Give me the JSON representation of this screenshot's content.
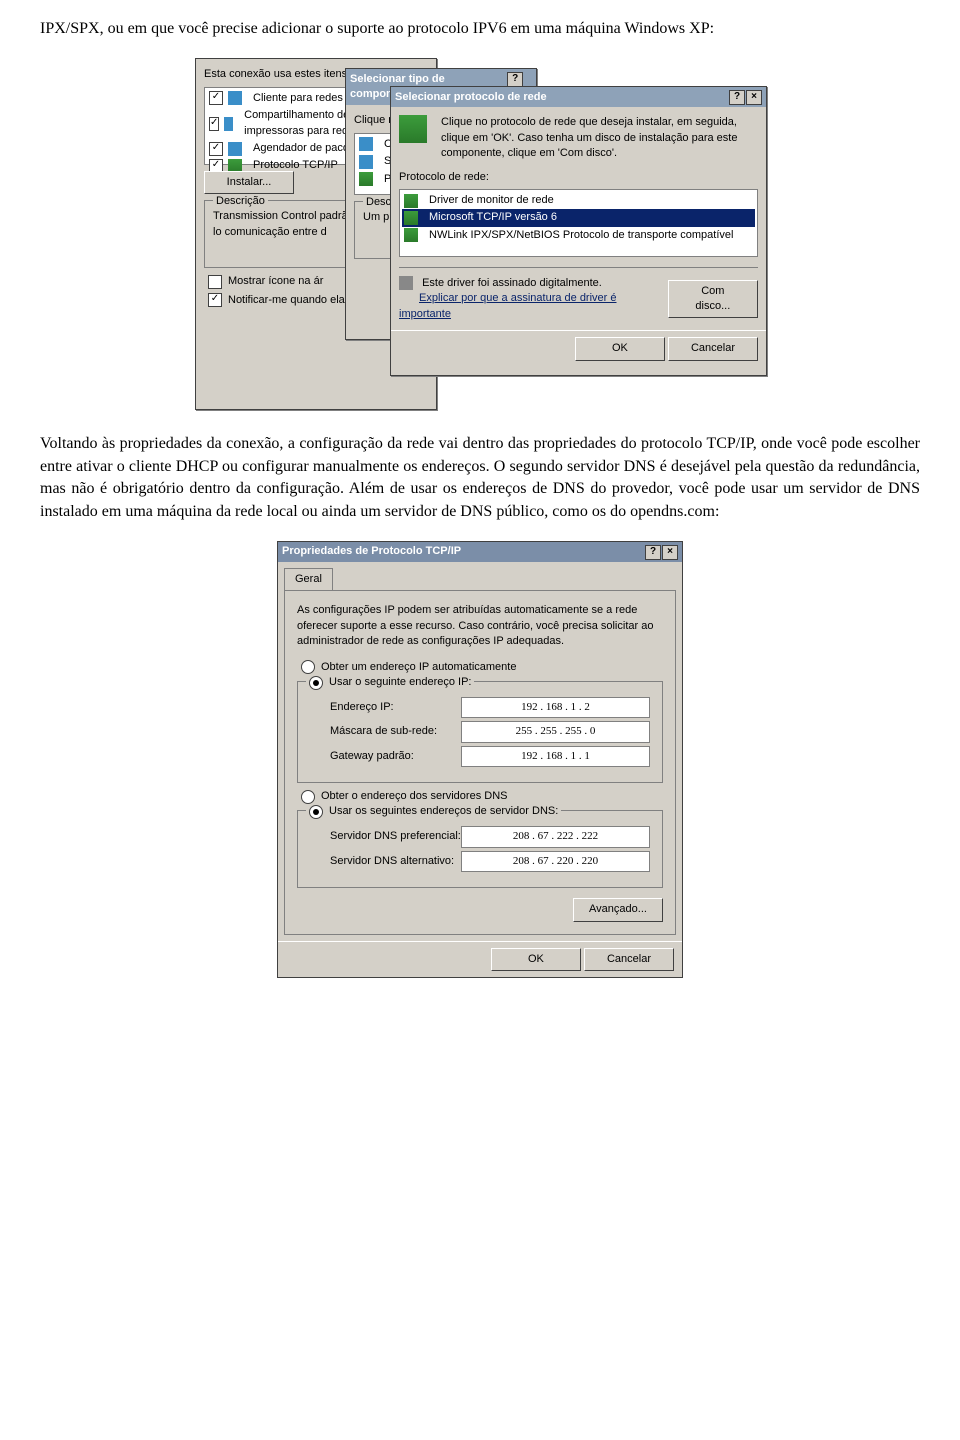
{
  "intro_text": "IPX/SPX, ou em que você precise adicionar o suporte ao protocolo IPV6 em uma máquina Windows XP:",
  "middle_text": "Voltando às propriedades da conexão, a configuração da rede vai dentro das propriedades do protocolo TCP/IP, onde você pode escolher entre ativar o cliente DHCP ou configurar manualmente os endereços. O segundo servidor DNS é desejável pela questão da redundância, mas não é obrigatório dentro da configuração. Além de usar os endereços de DNS do provedor, você pode usar um servidor de DNS instalado em uma máquina da rede local ou ainda um servidor de DNS público, como os do opendns.com:",
  "win_back": {
    "section_label": "Esta conexão usa estes itens:",
    "items": [
      "Cliente para redes Microsoft",
      "Compartilhamento de arquivos e impressoras para redes...",
      "Agendador de pacotes QoS",
      "Protocolo TCP/IP"
    ],
    "install": "Instalar...",
    "desc_heading": "Descrição",
    "desc_text": "Transmission Control padrão de rede de lo comunicação entre d",
    "chk1": "Mostrar ícone na ár",
    "chk2": "Notificar-me quando ela for limitada."
  },
  "win_mid": {
    "title": "Selecionar tipo de componente de rede",
    "instruction": "Clique no ti",
    "items": [
      "Client",
      "Servi",
      "Proto"
    ],
    "desc_heading": "Descriçã",
    "desc_text": "Um prot para se"
  },
  "win_front": {
    "title": "Selecionar protocolo de rede",
    "instruction": "Clique no protocolo de rede que deseja instalar, em seguida, clique em 'OK'. Caso tenha um disco de instalação para este componente, clique em 'Com disco'.",
    "group": "Protocolo de rede:",
    "items": [
      "Driver de monitor de rede",
      "Microsoft TCP/IP versão 6",
      "NWLink IPX/SPX/NetBIOS Protocolo de transporte compatível"
    ],
    "signed": "Este driver foi assinado digitalmente.",
    "why": "Explicar por que a assinatura de driver é importante",
    "comdisco": "Com disco...",
    "ok": "OK",
    "cancel": "Cancelar"
  },
  "tcpip": {
    "title": "Propriedades de Protocolo TCP/IP",
    "tab": "Geral",
    "intro": "As configurações IP podem ser atribuídas automaticamente se a rede oferecer suporte a esse recurso. Caso contrário, você precisa solicitar ao administrador de rede as configurações IP adequadas.",
    "radio_auto_ip": "Obter um endereço IP automaticamente",
    "radio_static_ip": "Usar o seguinte endereço IP:",
    "ip_label": "Endereço IP:",
    "ip_value": "192 . 168 .   1 .   2",
    "mask_label": "Máscara de sub-rede:",
    "mask_value": "255 . 255 . 255 .   0",
    "gw_label": "Gateway padrão:",
    "gw_value": "192 . 168 .   1 .   1",
    "radio_auto_dns": "Obter o endereço dos servidores DNS",
    "radio_static_dns": "Usar os seguintes endereços de servidor DNS:",
    "dns1_label": "Servidor DNS preferencial:",
    "dns1_value": "208 .  67 . 222 . 222",
    "dns2_label": "Servidor DNS alternativo:",
    "dns2_value": "208 .  67 . 220 . 220",
    "advanced": "Avançado...",
    "ok": "OK",
    "cancel": "Cancelar"
  }
}
